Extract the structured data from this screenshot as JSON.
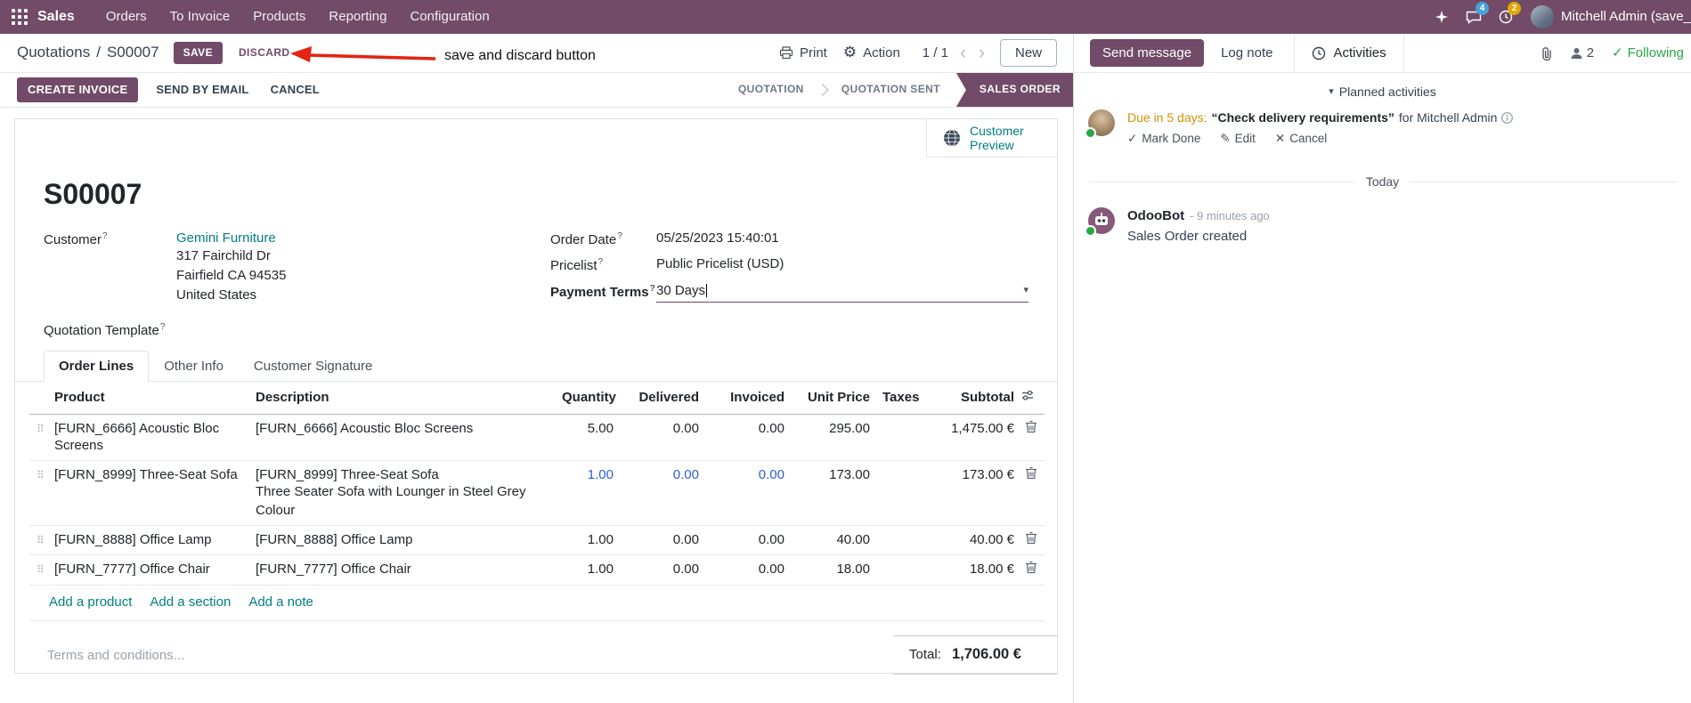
{
  "icons": {
    "help": "?",
    "caret_down": "▾",
    "grip": "⠿",
    "check": "✓",
    "pencil": "✎",
    "cross": "✕",
    "gear": "⚙",
    "prev": "‹",
    "next": "›"
  },
  "navbar": {
    "app_name": "Sales",
    "menus": [
      "Orders",
      "To Invoice",
      "Products",
      "Reporting",
      "Configuration"
    ],
    "messages_badge": "4",
    "activities_badge": "2",
    "user_name": "Mitchell Admin (save_discar"
  },
  "control_panel": {
    "breadcrumb_parent": "Quotations",
    "breadcrumb_separator": "/",
    "breadcrumb_current": "S00007",
    "save_label": "SAVE",
    "discard_label": "DISCARD",
    "print_label": "Print",
    "action_label": "Action",
    "pager": "1 / 1",
    "new_label": "New"
  },
  "annotation": {
    "text": "save and discard button"
  },
  "statusbar": {
    "buttons": [
      {
        "label": "CREATE INVOICE",
        "primary": true
      },
      {
        "label": "SEND BY EMAIL"
      },
      {
        "label": "CANCEL"
      }
    ],
    "stages": [
      {
        "label": "QUOTATION"
      },
      {
        "label": "QUOTATION SENT"
      },
      {
        "label": "SALES ORDER",
        "active": true
      }
    ]
  },
  "sheet": {
    "customer_preview_line1": "Customer",
    "customer_preview_line2": "Preview",
    "title": "S00007",
    "fields": {
      "customer": {
        "label": "Customer",
        "name": "Gemini Furniture",
        "address": [
          "317 Fairchild Dr",
          "Fairfield CA 94535",
          "United States"
        ]
      },
      "quotation_template": {
        "label": "Quotation Template"
      },
      "order_date": {
        "label": "Order Date",
        "value": "05/25/2023 15:40:01"
      },
      "pricelist": {
        "label": "Pricelist",
        "value": "Public Pricelist (USD)"
      },
      "payment_terms": {
        "label": "Payment Terms",
        "value": "30 Days"
      }
    },
    "tabs": [
      "Order Lines",
      "Other Info",
      "Customer Signature"
    ],
    "table": {
      "headers": [
        "Product",
        "Description",
        "Quantity",
        "Delivered",
        "Invoiced",
        "Unit Price",
        "Taxes",
        "Subtotal"
      ],
      "lines": [
        {
          "product": "[FURN_6666] Acoustic Bloc Screens",
          "desc1": "[FURN_6666] Acoustic Bloc Screens",
          "qty": "5.00",
          "delivered": "0.00",
          "invoiced": "0.00",
          "unit_price": "295.00",
          "subtotal": "1,475.00 €"
        },
        {
          "product": "[FURN_8999] Three-Seat Sofa",
          "desc1": "[FURN_8999] Three-Seat Sofa",
          "desc2": "Three Seater Sofa with Lounger in Steel Grey Colour",
          "qty": "1.00",
          "delivered": "0.00",
          "invoiced": "0.00",
          "unit_price": "173.00",
          "subtotal": "173.00 €",
          "modified": true
        },
        {
          "product": "[FURN_8888] Office Lamp",
          "desc1": "[FURN_8888] Office Lamp",
          "qty": "1.00",
          "delivered": "0.00",
          "invoiced": "0.00",
          "unit_price": "40.00",
          "subtotal": "40.00 €"
        },
        {
          "product": "[FURN_7777] Office Chair",
          "desc1": "[FURN_7777] Office Chair",
          "qty": "1.00",
          "delivered": "0.00",
          "invoiced": "0.00",
          "unit_price": "18.00",
          "subtotal": "18.00 €"
        }
      ],
      "footer_links": [
        "Add a product",
        "Add a section",
        "Add a note"
      ]
    },
    "terms_placeholder": "Terms and conditions...",
    "total_label": "Total:",
    "total_value": "1,706.00 €"
  },
  "chatter": {
    "send_message": "Send message",
    "log_note": "Log note",
    "activities_tab": "Activities",
    "followers_count": "2",
    "following": "Following",
    "planned_activities_header": "Planned activities",
    "activity": {
      "due": "Due in 5 days:",
      "summary": "“Check delivery requirements”",
      "for_text": "for Mitchell Admin",
      "mark_done": "Mark Done",
      "edit": "Edit",
      "cancel": "Cancel"
    },
    "date_divider": "Today",
    "message": {
      "author": "OdooBot",
      "time": "- 9 minutes ago",
      "body": "Sales Order created"
    }
  }
}
